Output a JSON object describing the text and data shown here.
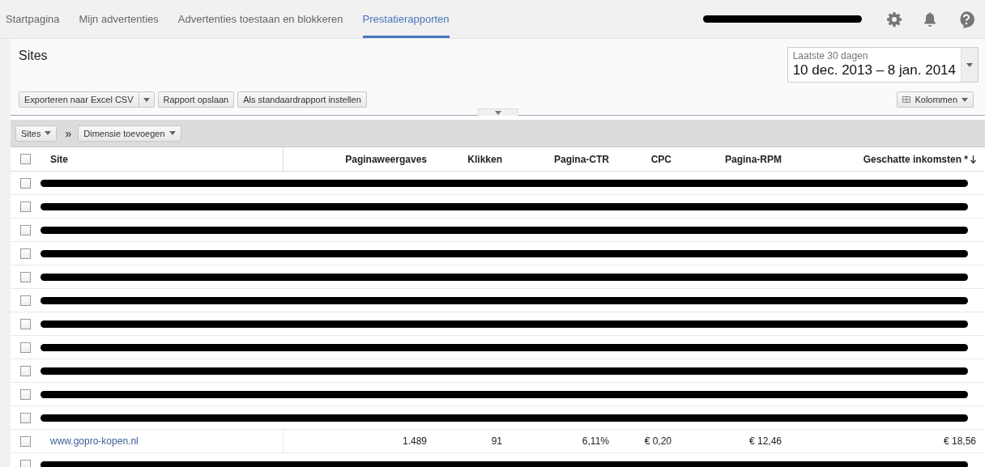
{
  "nav": {
    "tabs": [
      {
        "label": "Startpagina",
        "selected": false
      },
      {
        "label": "Mijn advertenties",
        "selected": false
      },
      {
        "label": "Advertenties toestaan en blokkeren",
        "selected": false
      },
      {
        "label": "Prestatierapporten",
        "selected": true
      }
    ]
  },
  "report": {
    "title": "Sites",
    "date_range": {
      "label": "Laatste 30 dagen",
      "value": "10 dec. 2013 – 8 jan. 2014"
    },
    "toolbar": {
      "export": "Exporteren naar Excel CSV",
      "save": "Rapport opslaan",
      "default": "Als standaardrapport instellen",
      "columns": "Kolommen"
    },
    "breadcrumb": {
      "dimension": "Sites",
      "separator": "»",
      "add": "Dimensie toevoegen"
    }
  },
  "table": {
    "select_all": {
      "checked": false
    },
    "columns": [
      "Site",
      "Paginaweergaves",
      "Klikken",
      "Pagina-CTR",
      "CPC",
      "Pagina-RPM",
      "Geschatte inkomsten *"
    ],
    "rows": [
      {
        "kind": "redacted",
        "checked": false
      },
      {
        "kind": "redacted",
        "checked": false
      },
      {
        "kind": "redacted",
        "checked": false
      },
      {
        "kind": "redacted",
        "checked": false
      },
      {
        "kind": "redacted",
        "checked": false
      },
      {
        "kind": "redacted",
        "checked": false
      },
      {
        "kind": "redacted",
        "checked": false
      },
      {
        "kind": "redacted",
        "checked": false
      },
      {
        "kind": "redacted",
        "checked": false
      },
      {
        "kind": "redacted",
        "checked": false
      },
      {
        "kind": "redacted",
        "checked": false
      },
      {
        "kind": "data",
        "checked": false,
        "cells": [
          "www.gopro-kopen.nl",
          "1.489",
          "91",
          "6,11%",
          "€ 0,20",
          "€ 12,46",
          "€ 18,56"
        ]
      },
      {
        "kind": "redacted",
        "checked": false
      }
    ]
  }
}
